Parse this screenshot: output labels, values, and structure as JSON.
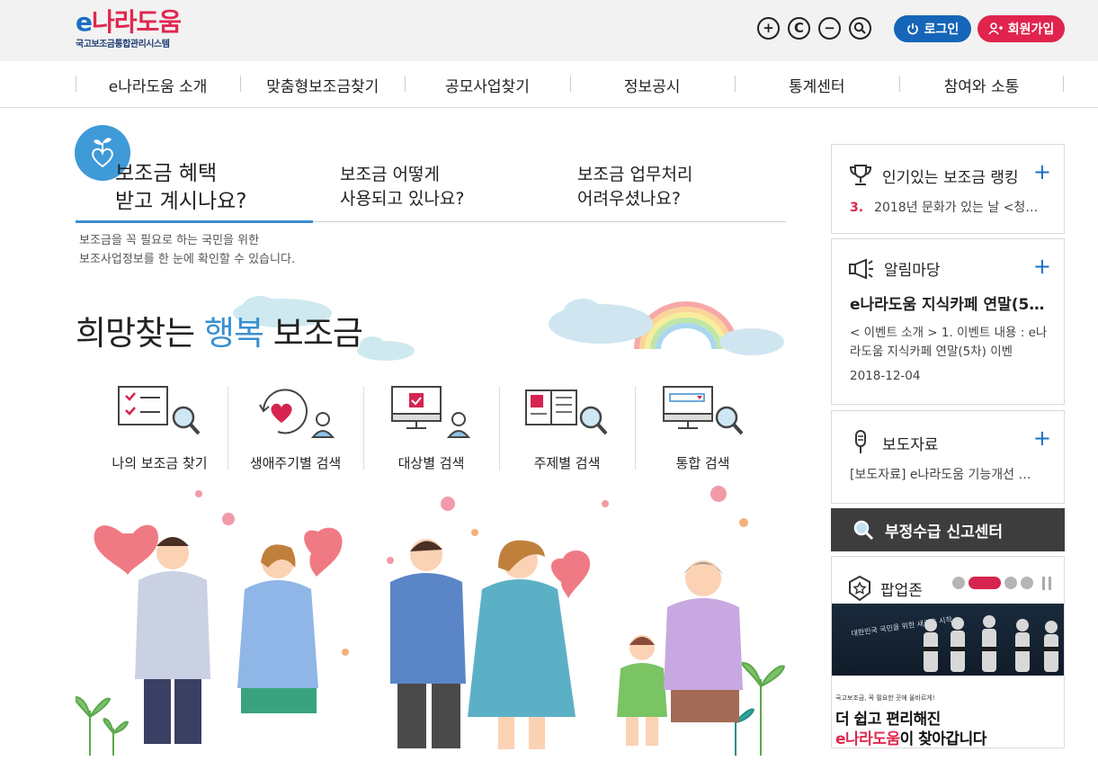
{
  "header": {
    "logo": {
      "e": "e",
      "rest": "나라도움",
      "subtitle": "국고보조금통합관리시스템"
    },
    "tools": [
      {
        "name": "zoom-in-icon",
        "glyph": "+"
      },
      {
        "name": "reset-icon",
        "glyph": "C"
      },
      {
        "name": "zoom-out-icon",
        "glyph": "−"
      },
      {
        "name": "search-icon",
        "glyph": ""
      }
    ],
    "login_label": "로그인",
    "join_label": "회원가입"
  },
  "nav": {
    "items": [
      {
        "label": "e나라도움 소개"
      },
      {
        "label": "맞춤형보조금찾기"
      },
      {
        "label": "공모사업찾기"
      },
      {
        "label": "정보공시"
      },
      {
        "label": "통계센터"
      },
      {
        "label": "참여와 소통"
      }
    ]
  },
  "intro": {
    "tabs": [
      {
        "line1": "보조금 혜택",
        "line2": "받고 계시나요?"
      },
      {
        "line1": "보조금 어떻게",
        "line2": "사용되고 있나요?"
      },
      {
        "line1": "보조금 업무처리",
        "line2": "어려우셨나요?"
      }
    ],
    "desc_line1": "보조금을 꼭 필요로 하는 국민을 위한",
    "desc_line2": "보조사업정보를 한 눈에 확인할 수 있습니다.",
    "hero_pre": "희망찾는 ",
    "hero_hl": "행복",
    "hero_post": " 보조금",
    "categories": [
      {
        "label": "나의 보조금 찾기",
        "icon": "checklist-search-icon"
      },
      {
        "label": "생애주기별 검색",
        "icon": "lifecycle-heart-icon"
      },
      {
        "label": "대상별 검색",
        "icon": "monitor-person-icon"
      },
      {
        "label": "주제별 검색",
        "icon": "book-search-icon"
      },
      {
        "label": "통합 검색",
        "icon": "monitor-search-icon"
      }
    ]
  },
  "ranking": {
    "title": "인기있는 보조금 랭킹",
    "rank": "3.",
    "item": "2018년 문화가 있는 날 <청…"
  },
  "notice": {
    "title": "알림마당",
    "headline": "e나라도움 지식카페 연말(5…",
    "body": "< 이벤트 소개 >  1. 이벤트 내용 : e나라도움 지식카페 연말(5차) 이벤",
    "date": "2018-12-04"
  },
  "press": {
    "title": "보도자료",
    "item": "[보도자료] e나라도움 기능개선 …"
  },
  "report": {
    "label": "부정수급 신고센터"
  },
  "popup": {
    "title": "팝업존",
    "banner_text": "대한민국 국민을 위한 새로운 시작",
    "caption": "국고보조금, 꼭 필요한 곳에 올바르게!",
    "line1": "더 쉽고 편리해진",
    "line2_brand": "e나라도움",
    "line2_rest": "이 찾아갑니다"
  },
  "colors": {
    "brand_blue": "#1c6ec4",
    "brand_red": "#e0284f",
    "accent": "#3a8fd0"
  }
}
